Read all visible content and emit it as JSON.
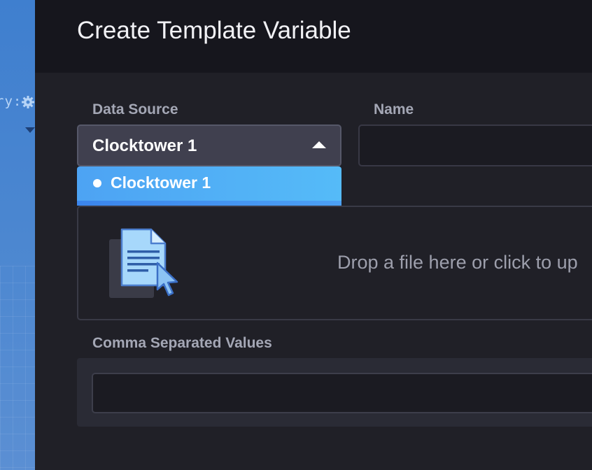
{
  "background": {
    "partial_text": "ry:",
    "icons": [
      "gear-icon",
      "caret-down-icon"
    ]
  },
  "dialog": {
    "title": "Create Template Variable",
    "data_source": {
      "label": "Data Source",
      "selected": "Clocktower 1",
      "options": [
        "Clocktower 1"
      ]
    },
    "name": {
      "label": "Name",
      "value": "",
      "placeholder": ""
    },
    "dropzone": {
      "text": "Drop a file here or click to up",
      "icon": "file-upload-icon"
    },
    "csv": {
      "label": "Comma Separated Values",
      "value": "",
      "placeholder": ""
    }
  },
  "colors": {
    "accent": "#4da3f3",
    "dialog_bg": "#16161d",
    "body_bg": "#202027"
  }
}
